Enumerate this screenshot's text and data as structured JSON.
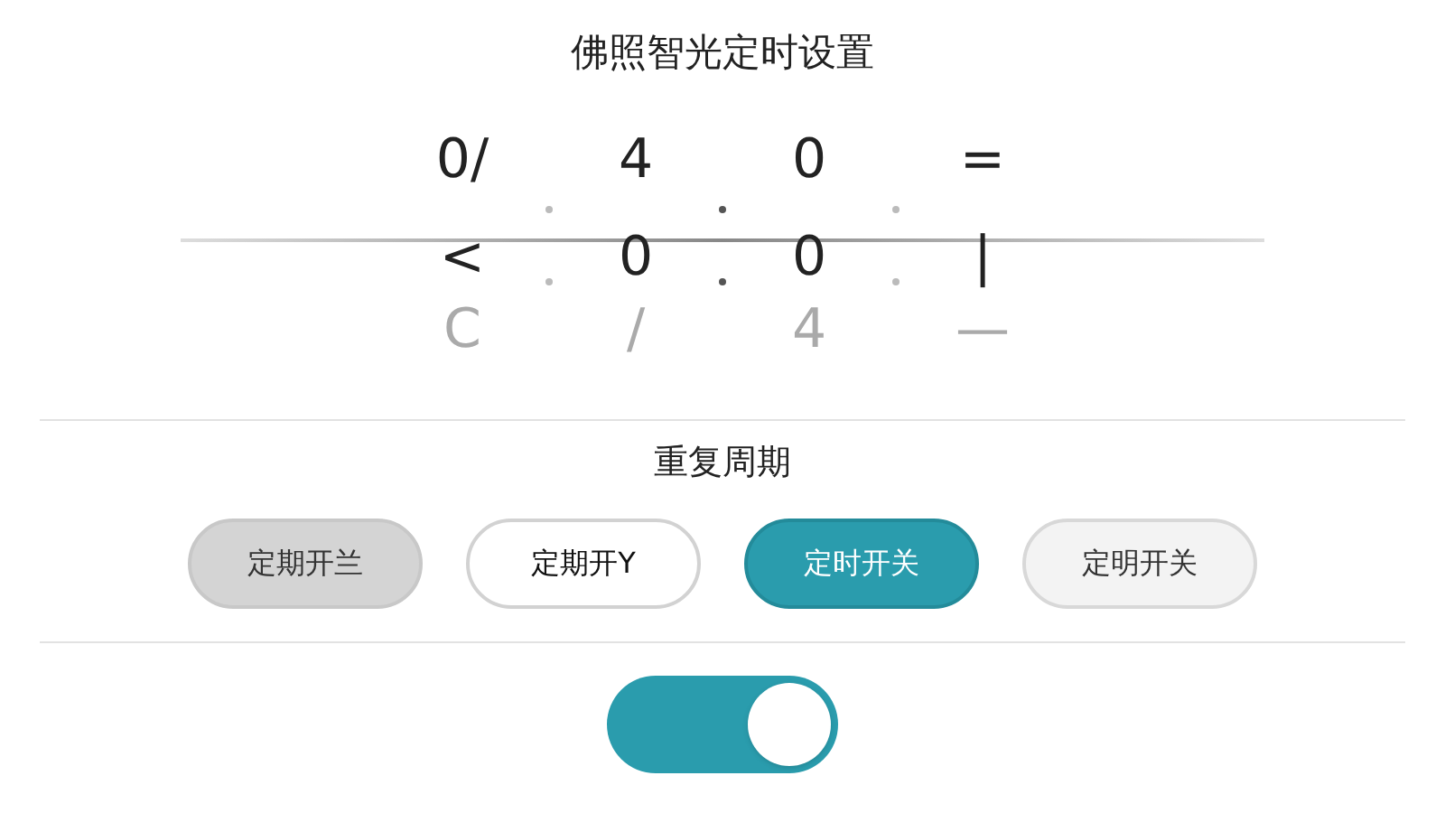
{
  "title": "佛照智光定时设置",
  "picker": {
    "columns": [
      {
        "items": [
          {
            "text": "0/",
            "faded": false
          },
          {
            "text": "<",
            "faded": false
          },
          {
            "text": "C",
            "faded": true
          }
        ]
      },
      {
        "items": [
          {
            "text": "4",
            "faded": false
          },
          {
            "text": "0",
            "faded": false
          },
          {
            "text": "/",
            "faded": true
          }
        ]
      },
      {
        "items": [
          {
            "text": "0",
            "faded": false
          },
          {
            "text": "0",
            "faded": false
          },
          {
            "text": "4",
            "faded": true
          }
        ]
      },
      {
        "items": [
          {
            "text": "=",
            "faded": false
          },
          {
            "text": "|",
            "faded": false
          },
          {
            "text": "—",
            "faded": true
          }
        ]
      }
    ]
  },
  "repeat": {
    "title": "重复周期",
    "options": [
      {
        "label": "定期开兰",
        "selected": false,
        "kind": "filled"
      },
      {
        "label": "定期开Y",
        "selected": false,
        "kind": "outlined"
      },
      {
        "label": "定时开关",
        "selected": true
      },
      {
        "label": "定明开关",
        "selected": false,
        "kind": "light"
      }
    ]
  },
  "toggle": {
    "on": true
  }
}
